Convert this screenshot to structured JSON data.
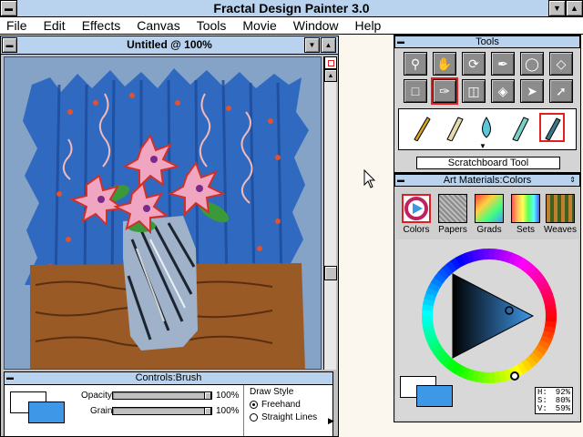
{
  "app": {
    "title": "Fractal Design Painter 3.0"
  },
  "menu": [
    "File",
    "Edit",
    "Effects",
    "Canvas",
    "Tools",
    "Movie",
    "Window",
    "Help"
  ],
  "document": {
    "title": "Untitled @ 100%"
  },
  "controls": {
    "title": "Controls:Brush",
    "opacity_label": "Opacity",
    "opacity_value": "100%",
    "opacity_level": 1.0,
    "grain_label": "Grain",
    "grain_value": "100%",
    "grain_level": 1.0,
    "draw_style_label": "Draw Style",
    "option_freehand": "Freehand",
    "option_straight": "Straight Lines",
    "selected_option": "Freehand",
    "primary_color": "#ffffff",
    "secondary_color": "#3f97e8"
  },
  "tools": {
    "title": "Tools",
    "row1": [
      "magnifier-icon",
      "grabber-icon",
      "rotate-icon",
      "dropper-icon",
      "oval-select-icon",
      "lasso-icon"
    ],
    "row2": [
      "rect-select-icon",
      "brush-icon",
      "paint-bucket-icon",
      "fill-icon",
      "pointer-icon",
      "selection-adjuster-icon"
    ],
    "brushes": [
      "pencil-icon",
      "eraser-icon",
      "water-icon",
      "chalk-icon",
      "scratchboard-icon"
    ],
    "selected_tool_name": "Scratchboard Tool"
  },
  "art_materials": {
    "title": "Art Materials:Colors",
    "tabs": [
      "Colors",
      "Papers",
      "Grads",
      "Sets",
      "Weaves"
    ],
    "selected_tab": "Colors",
    "hsv": {
      "h_label": "H:",
      "h_value": "92%",
      "s_label": "S:",
      "s_value": "80%",
      "v_label": "V:",
      "v_value": "59%"
    },
    "current_color": "#3f97e8",
    "back_color": "#ffffff"
  }
}
